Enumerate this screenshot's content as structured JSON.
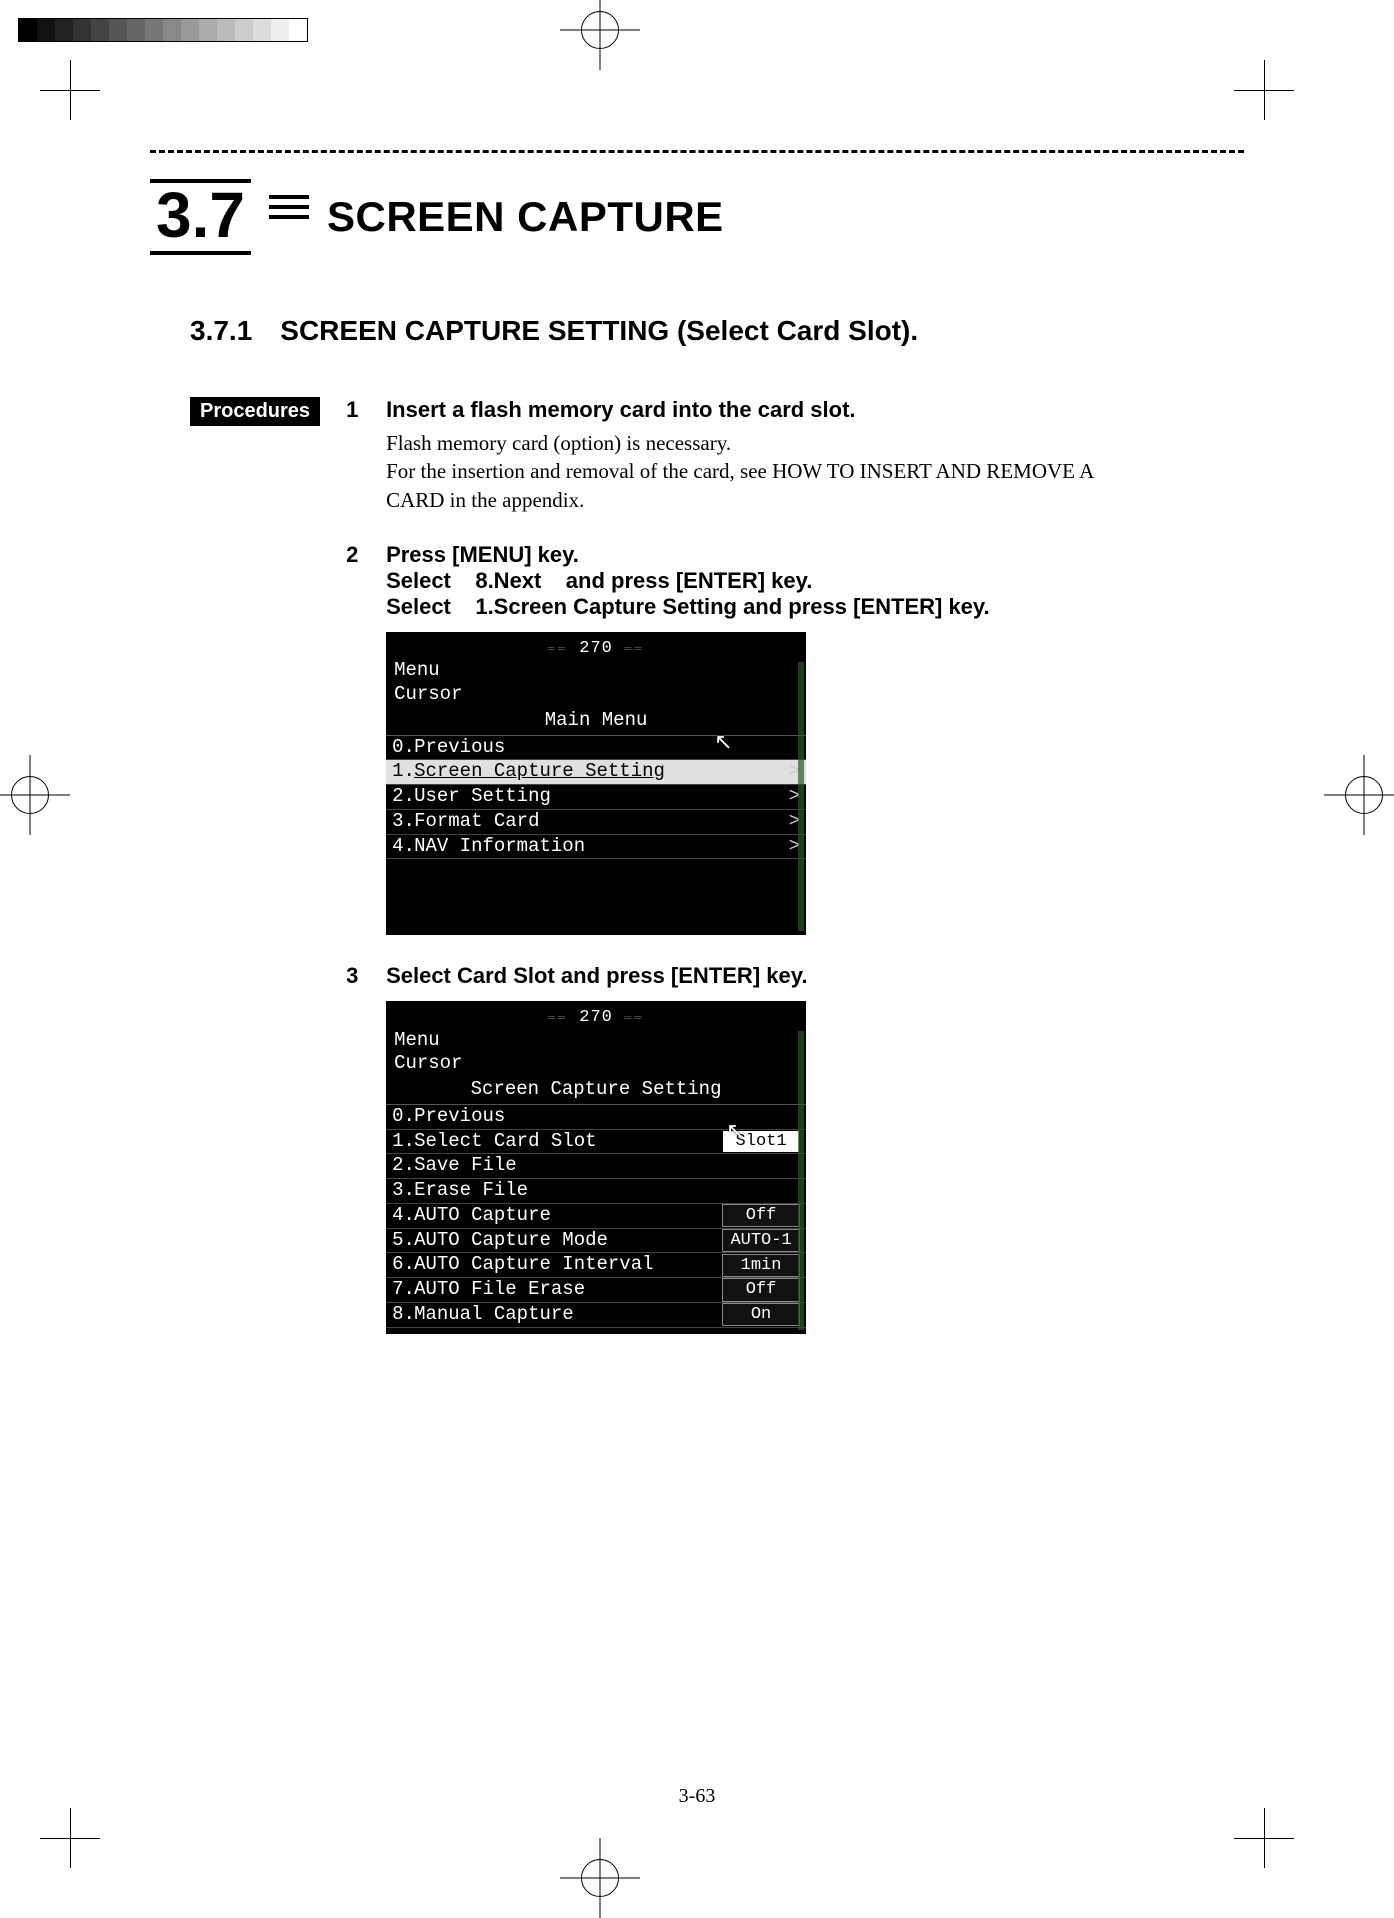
{
  "section_number": "3.7",
  "section_title": "SCREEN CAPTURE",
  "subsection_number": "3.7.1",
  "subsection_title": "SCREEN CAPTURE SETTING (Select Card Slot).",
  "procedures_label": "Procedures",
  "steps": [
    {
      "num": "1",
      "title": "Insert a flash memory card into the card slot.",
      "body": "Flash memory card (option) is necessary.\nFor the insertion and removal of the card, see HOW TO INSERT AND REMOVE A CARD in the appendix."
    },
    {
      "num": "2",
      "title": "Press [MENU] key.\nSelect    8.Next    and press [ENTER] key.\nSelect    1.Screen Capture Setting and press [ENTER] key.",
      "body": ""
    },
    {
      "num": "3",
      "title": "Select Card Slot and press [ENTER] key.",
      "body": ""
    }
  ],
  "device1": {
    "compass": "270",
    "line1": "Menu",
    "line2": "Cursor",
    "menu_title": "Main Menu",
    "rows": [
      {
        "n": "0.",
        "label": "Previous",
        "arrow": ""
      },
      {
        "n": "1.",
        "label": "Screen Capture Setting",
        "arrow": ">",
        "selected": true
      },
      {
        "n": "2.",
        "label": "User Setting",
        "arrow": ">"
      },
      {
        "n": "3.",
        "label": "Format Card",
        "arrow": ">"
      },
      {
        "n": "4.",
        "label": "NAV Information",
        "arrow": ">"
      }
    ]
  },
  "device2": {
    "compass": "270",
    "line1": "Menu",
    "line2": "Cursor",
    "menu_title": "Screen Capture Setting",
    "rows": [
      {
        "n": "0.",
        "label": "Previous",
        "val": ""
      },
      {
        "n": "1.",
        "label": "Select Card Slot",
        "val": "Slot1",
        "selected": true
      },
      {
        "n": "2.",
        "label": "Save File",
        "val": ""
      },
      {
        "n": "3.",
        "label": "Erase File",
        "val": ""
      },
      {
        "n": "4.",
        "label": "AUTO Capture",
        "val": "Off"
      },
      {
        "n": "5.",
        "label": "AUTO Capture Mode",
        "val": "AUTO-1"
      },
      {
        "n": "6.",
        "label": "AUTO Capture Interval",
        "val": "1min"
      },
      {
        "n": "7.",
        "label": "AUTO File Erase",
        "val": "Off"
      },
      {
        "n": "8.",
        "label": "Manual Capture",
        "val": "On"
      }
    ]
  },
  "page_number": "3-63"
}
